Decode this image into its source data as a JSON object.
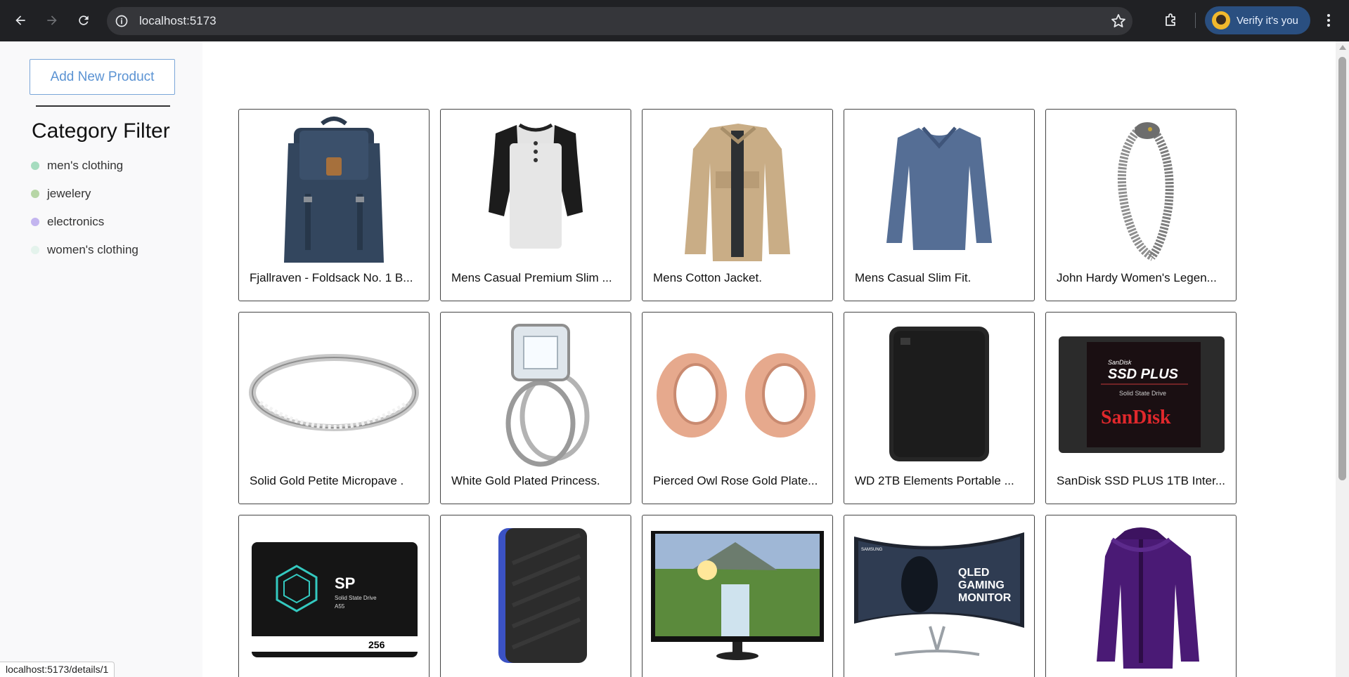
{
  "browser": {
    "url": "localhost:5173",
    "profile_button": "Verify it's you",
    "status_url": "localhost:5173/details/1"
  },
  "sidebar": {
    "add_button": "Add New Product",
    "filter_title": "Category Filter",
    "categories": [
      {
        "label": "men's clothing",
        "color": "#a6dcbf"
      },
      {
        "label": "jewelery",
        "color": "#b7d6a6"
      },
      {
        "label": "electronics",
        "color": "#c3b5ef"
      },
      {
        "label": "women's clothing",
        "color": "#e4f3ec"
      }
    ]
  },
  "products": [
    {
      "title": "Fjallraven - Foldsack No. 1 B...",
      "image": "backpack"
    },
    {
      "title": "Mens Casual Premium Slim ...",
      "image": "raglan-tshirt"
    },
    {
      "title": "Mens Cotton Jacket.",
      "image": "cotton-jacket"
    },
    {
      "title": "Mens Casual Slim Fit.",
      "image": "long-sleeve-shirt"
    },
    {
      "title": "John Hardy Women's Legen...",
      "image": "dragon-bracelet"
    },
    {
      "title": "Solid Gold Petite Micropave .",
      "image": "silver-ring"
    },
    {
      "title": "White Gold Plated Princess.",
      "image": "princess-ring"
    },
    {
      "title": "Pierced Owl Rose Gold Plate...",
      "image": "rose-gold-plugs"
    },
    {
      "title": "WD 2TB Elements Portable ...",
      "image": "wd-hard-drive"
    },
    {
      "title": "SanDisk SSD PLUS 1TB Inter...",
      "image": "sandisk-ssd"
    },
    {
      "title": "",
      "image": "silicon-power-ssd"
    },
    {
      "title": "",
      "image": "wd-gaming-drive"
    },
    {
      "title": "",
      "image": "acer-monitor"
    },
    {
      "title": "",
      "image": "samsung-curved-monitor"
    },
    {
      "title": "",
      "image": "purple-jacket"
    }
  ],
  "ssd_labels": {
    "sandisk_small": "SanDisk",
    "sandisk_main": "SSD PLUS",
    "sandisk_sub": "Solid State Drive",
    "sandisk_brand": "SanDisk",
    "sp_logo": "SP",
    "sp_line1": "Solid State Drive",
    "sp_line2": "A55",
    "sp_capacity": "256",
    "samsung_brand": "SAMSUNG",
    "qled_line1": "QLED",
    "qled_line2": "GAMING",
    "qled_line3": "MONITOR"
  }
}
